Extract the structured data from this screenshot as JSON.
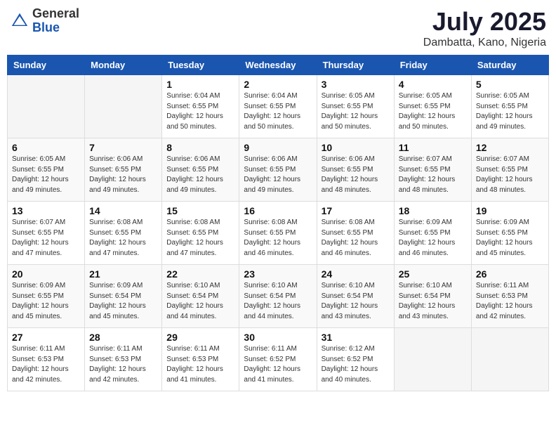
{
  "header": {
    "logo_general": "General",
    "logo_blue": "Blue",
    "month_year": "July 2025",
    "location": "Dambatta, Kano, Nigeria"
  },
  "weekdays": [
    "Sunday",
    "Monday",
    "Tuesday",
    "Wednesday",
    "Thursday",
    "Friday",
    "Saturday"
  ],
  "weeks": [
    [
      {
        "day": "",
        "info": ""
      },
      {
        "day": "",
        "info": ""
      },
      {
        "day": "1",
        "info": "Sunrise: 6:04 AM\nSunset: 6:55 PM\nDaylight: 12 hours and 50 minutes."
      },
      {
        "day": "2",
        "info": "Sunrise: 6:04 AM\nSunset: 6:55 PM\nDaylight: 12 hours and 50 minutes."
      },
      {
        "day": "3",
        "info": "Sunrise: 6:05 AM\nSunset: 6:55 PM\nDaylight: 12 hours and 50 minutes."
      },
      {
        "day": "4",
        "info": "Sunrise: 6:05 AM\nSunset: 6:55 PM\nDaylight: 12 hours and 50 minutes."
      },
      {
        "day": "5",
        "info": "Sunrise: 6:05 AM\nSunset: 6:55 PM\nDaylight: 12 hours and 49 minutes."
      }
    ],
    [
      {
        "day": "6",
        "info": "Sunrise: 6:05 AM\nSunset: 6:55 PM\nDaylight: 12 hours and 49 minutes."
      },
      {
        "day": "7",
        "info": "Sunrise: 6:06 AM\nSunset: 6:55 PM\nDaylight: 12 hours and 49 minutes."
      },
      {
        "day": "8",
        "info": "Sunrise: 6:06 AM\nSunset: 6:55 PM\nDaylight: 12 hours and 49 minutes."
      },
      {
        "day": "9",
        "info": "Sunrise: 6:06 AM\nSunset: 6:55 PM\nDaylight: 12 hours and 49 minutes."
      },
      {
        "day": "10",
        "info": "Sunrise: 6:06 AM\nSunset: 6:55 PM\nDaylight: 12 hours and 48 minutes."
      },
      {
        "day": "11",
        "info": "Sunrise: 6:07 AM\nSunset: 6:55 PM\nDaylight: 12 hours and 48 minutes."
      },
      {
        "day": "12",
        "info": "Sunrise: 6:07 AM\nSunset: 6:55 PM\nDaylight: 12 hours and 48 minutes."
      }
    ],
    [
      {
        "day": "13",
        "info": "Sunrise: 6:07 AM\nSunset: 6:55 PM\nDaylight: 12 hours and 47 minutes."
      },
      {
        "day": "14",
        "info": "Sunrise: 6:08 AM\nSunset: 6:55 PM\nDaylight: 12 hours and 47 minutes."
      },
      {
        "day": "15",
        "info": "Sunrise: 6:08 AM\nSunset: 6:55 PM\nDaylight: 12 hours and 47 minutes."
      },
      {
        "day": "16",
        "info": "Sunrise: 6:08 AM\nSunset: 6:55 PM\nDaylight: 12 hours and 46 minutes."
      },
      {
        "day": "17",
        "info": "Sunrise: 6:08 AM\nSunset: 6:55 PM\nDaylight: 12 hours and 46 minutes."
      },
      {
        "day": "18",
        "info": "Sunrise: 6:09 AM\nSunset: 6:55 PM\nDaylight: 12 hours and 46 minutes."
      },
      {
        "day": "19",
        "info": "Sunrise: 6:09 AM\nSunset: 6:55 PM\nDaylight: 12 hours and 45 minutes."
      }
    ],
    [
      {
        "day": "20",
        "info": "Sunrise: 6:09 AM\nSunset: 6:55 PM\nDaylight: 12 hours and 45 minutes."
      },
      {
        "day": "21",
        "info": "Sunrise: 6:09 AM\nSunset: 6:54 PM\nDaylight: 12 hours and 45 minutes."
      },
      {
        "day": "22",
        "info": "Sunrise: 6:10 AM\nSunset: 6:54 PM\nDaylight: 12 hours and 44 minutes."
      },
      {
        "day": "23",
        "info": "Sunrise: 6:10 AM\nSunset: 6:54 PM\nDaylight: 12 hours and 44 minutes."
      },
      {
        "day": "24",
        "info": "Sunrise: 6:10 AM\nSunset: 6:54 PM\nDaylight: 12 hours and 43 minutes."
      },
      {
        "day": "25",
        "info": "Sunrise: 6:10 AM\nSunset: 6:54 PM\nDaylight: 12 hours and 43 minutes."
      },
      {
        "day": "26",
        "info": "Sunrise: 6:11 AM\nSunset: 6:53 PM\nDaylight: 12 hours and 42 minutes."
      }
    ],
    [
      {
        "day": "27",
        "info": "Sunrise: 6:11 AM\nSunset: 6:53 PM\nDaylight: 12 hours and 42 minutes."
      },
      {
        "day": "28",
        "info": "Sunrise: 6:11 AM\nSunset: 6:53 PM\nDaylight: 12 hours and 42 minutes."
      },
      {
        "day": "29",
        "info": "Sunrise: 6:11 AM\nSunset: 6:53 PM\nDaylight: 12 hours and 41 minutes."
      },
      {
        "day": "30",
        "info": "Sunrise: 6:11 AM\nSunset: 6:52 PM\nDaylight: 12 hours and 41 minutes."
      },
      {
        "day": "31",
        "info": "Sunrise: 6:12 AM\nSunset: 6:52 PM\nDaylight: 12 hours and 40 minutes."
      },
      {
        "day": "",
        "info": ""
      },
      {
        "day": "",
        "info": ""
      }
    ]
  ]
}
